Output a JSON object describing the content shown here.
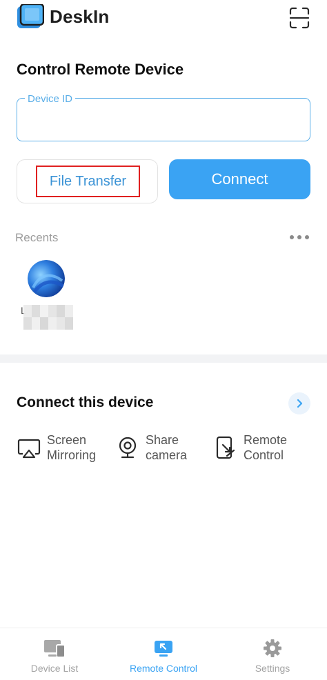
{
  "header": {
    "app_name": "DeskIn"
  },
  "page_title": "Control Remote Device",
  "device_id": {
    "label": "Device ID",
    "value": ""
  },
  "buttons": {
    "file_transfer": "File Transfer",
    "connect": "Connect"
  },
  "recents": {
    "label": "Recents",
    "items": [
      {
        "name": "L"
      }
    ]
  },
  "connect_section": {
    "title": "Connect this device",
    "features": [
      {
        "line1": "Screen",
        "line2": "Mirroring",
        "icon": "screen-mirroring-icon"
      },
      {
        "line1": "Share",
        "line2": "camera",
        "icon": "camera-icon"
      },
      {
        "line1": "Remote",
        "line2": "Control",
        "icon": "remote-control-icon"
      }
    ]
  },
  "bottom_nav": [
    {
      "label": "Device List",
      "icon": "device-list-icon",
      "active": false
    },
    {
      "label": "Remote Control",
      "icon": "remote-control-icon",
      "active": true
    },
    {
      "label": "Settings",
      "icon": "gear-icon",
      "active": false
    }
  ],
  "colors": {
    "accent": "#3aa3f3",
    "highlight_box": "#e02020",
    "muted_text": "#9c9c9c"
  }
}
